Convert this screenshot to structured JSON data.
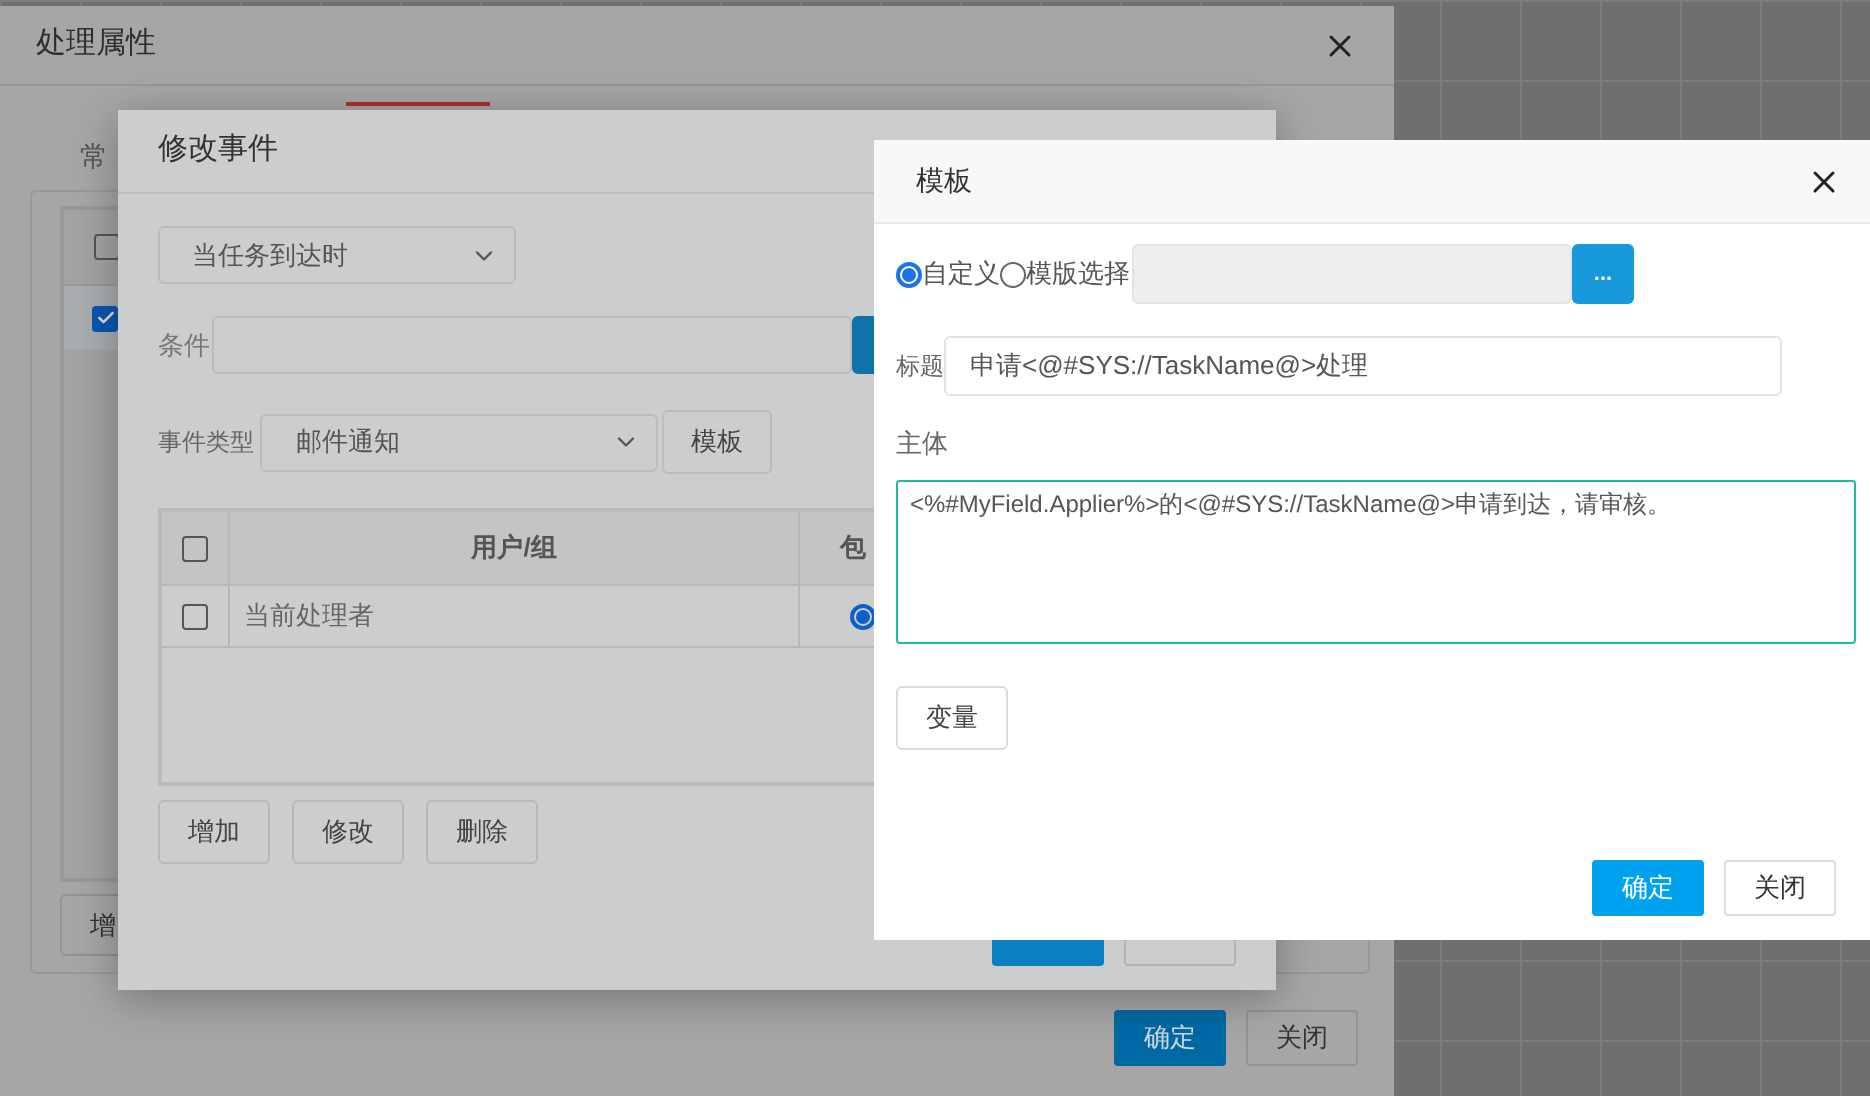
{
  "outer_dialog": {
    "title": "处理属性",
    "tabs": [
      {
        "label": "常",
        "selected": false
      },
      {
        "selected": true
      }
    ],
    "table": {
      "header_checked": false,
      "rows": [
        {
          "checked": true
        }
      ]
    },
    "buttons": [
      "增"
    ],
    "footer_buttons": [
      {
        "label": "确定",
        "kind": "primary"
      },
      {
        "label": "关闭",
        "kind": "default"
      }
    ]
  },
  "event_dialog": {
    "title": "修改事件",
    "trigger": "当任务到达时",
    "condition": {
      "label": "条件"
    },
    "event_type": {
      "label": "事件类型",
      "value": "邮件通知"
    },
    "template_button": "模板",
    "table": {
      "columns": [
        "用户/组",
        "包"
      ],
      "header_checked": false,
      "rows": [
        {
          "user": "当前处理者",
          "checked": false,
          "include_selected": true
        }
      ]
    },
    "buttons": [
      "增加",
      "修改",
      "删除"
    ],
    "footer_buttons": [
      {
        "kind": "primary"
      },
      {
        "kind": "default"
      }
    ]
  },
  "template_dialog": {
    "title": "模板",
    "sources": [
      {
        "label": "自定义",
        "selected": true
      },
      {
        "label": "模版选择",
        "selected": false
      }
    ],
    "browse_button": "...",
    "subject": {
      "label": "标题",
      "value": "申请<@#SYS://TaskName@>处理"
    },
    "body": {
      "label": "主体",
      "value": "<%#MyField.Applier%>的<@#SYS://TaskName@>申请到达，请审核。"
    },
    "variable_button": "变量",
    "footer_buttons": [
      {
        "label": "确定",
        "kind": "primary"
      },
      {
        "label": "关闭",
        "kind": "default"
      }
    ]
  }
}
